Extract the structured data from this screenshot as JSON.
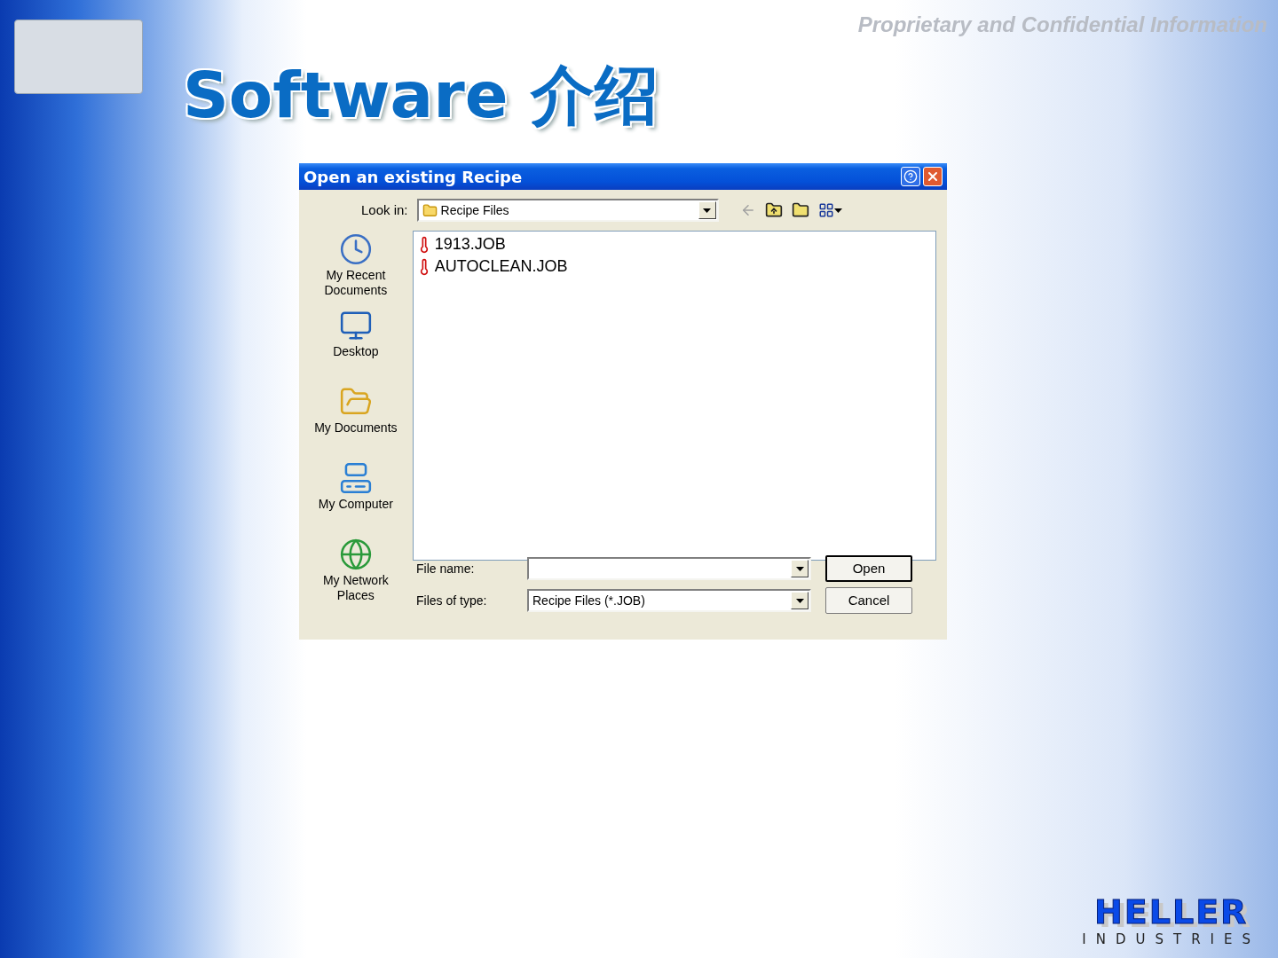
{
  "slide": {
    "confidential_note": "Proprietary and Confidential Information",
    "title": "Software 介绍",
    "logo": {
      "name": "HELLER",
      "subtitle": "INDUSTRIES"
    }
  },
  "dialog": {
    "title": "Open an existing Recipe",
    "look_in": {
      "label": "Look in:",
      "value": "Recipe Files"
    },
    "places": [
      {
        "kind": "recent",
        "label": "My Recent Documents"
      },
      {
        "kind": "desktop",
        "label": "Desktop"
      },
      {
        "kind": "documents",
        "label": "My Documents"
      },
      {
        "kind": "computer",
        "label": "My Computer"
      },
      {
        "kind": "network",
        "label": "My Network Places"
      }
    ],
    "files": [
      {
        "name": "1913.JOB"
      },
      {
        "name": "AUTOCLEAN.JOB"
      }
    ],
    "file_name": {
      "label": "File name:"
    },
    "file_type": {
      "label": "Files of type:",
      "value": "Recipe Files (*.JOB)"
    },
    "buttons": [
      {
        "label": "Open",
        "default": true
      },
      {
        "label": "Cancel",
        "default": false
      }
    ]
  }
}
